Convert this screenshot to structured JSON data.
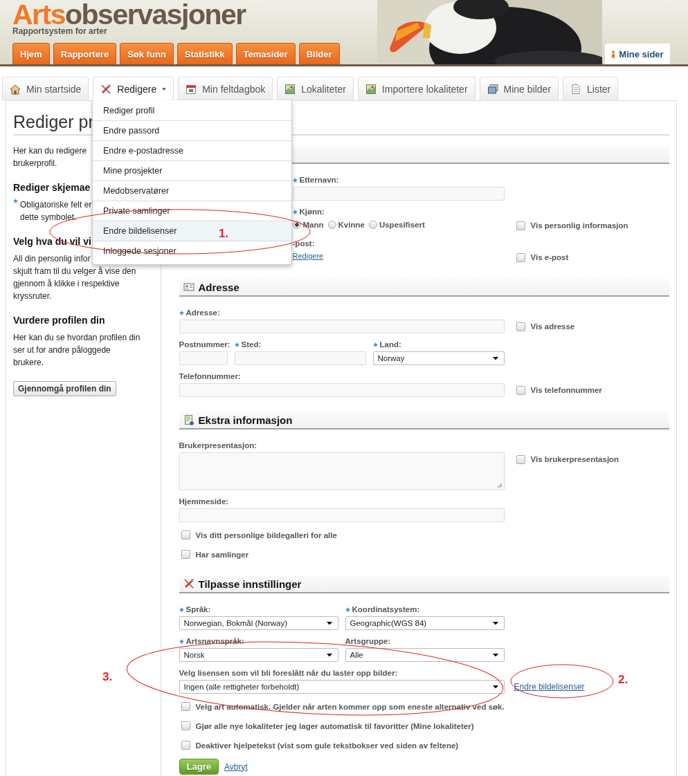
{
  "site": {
    "brand_first": "Arts",
    "brand_rest": "observasjoner",
    "tagline": "Rapportsystem for arter"
  },
  "main_nav": [
    {
      "label": "Hjem"
    },
    {
      "label": "Rapportere"
    },
    {
      "label": "Søk funn"
    },
    {
      "label": "Statistikk"
    },
    {
      "label": "Temasider"
    },
    {
      "label": "Bilder"
    }
  ],
  "user_nav": {
    "label": "Mine sider"
  },
  "tabs": [
    {
      "label": "Min startside",
      "selected": false,
      "menu": false
    },
    {
      "label": "Redigere",
      "selected": true,
      "menu": true
    },
    {
      "label": "Min feltdagbok",
      "selected": false,
      "menu": false
    },
    {
      "label": "Lokaliteter",
      "selected": false,
      "menu": false
    },
    {
      "label": "Importere lokaliteter",
      "selected": false,
      "menu": false
    },
    {
      "label": "Mine bilder",
      "selected": false,
      "menu": false
    },
    {
      "label": "Lister",
      "selected": false,
      "menu": false
    }
  ],
  "menu": {
    "items": [
      {
        "label": "Rediger profil",
        "selected": false
      },
      {
        "label": "Endre passord",
        "selected": false
      },
      {
        "label": "Endre e-postadresse",
        "selected": false
      },
      {
        "label": "Mine prosjekter",
        "selected": false
      },
      {
        "label": "Medobservatører",
        "selected": false
      },
      {
        "label": "Private samlinger",
        "selected": false
      },
      {
        "label": "Endre bildelisenser",
        "selected": true
      },
      {
        "label": "Inloggede sesjoner",
        "selected": false
      }
    ]
  },
  "page_title": "Rediger pr",
  "sidebar": [
    {
      "kind": "paragraph",
      "lines": [
        "Her kan du redigere",
        "brukerprofil."
      ]
    },
    {
      "kind": "heading",
      "text": "Rediger skjemae"
    },
    {
      "kind": "note",
      "lines": [
        "Obligatoriske felt er",
        "dette symbolet."
      ]
    },
    {
      "kind": "heading",
      "text": "Velg hva du vil vi"
    },
    {
      "kind": "paragraph",
      "lines": [
        "All din personlig infor",
        "skjult fram til du velger å vise den",
        "gjennom å klikke i respektive",
        "kryssruter."
      ]
    },
    {
      "kind": "heading",
      "text": "Vurdere profilen din"
    },
    {
      "kind": "paragraph",
      "lines": [
        "Her kan du se hvordan profilen din",
        "ser ut for andre påloggede",
        "brukere."
      ]
    },
    {
      "kind": "button",
      "text": "Gjennomgå profilen din"
    }
  ],
  "sections": [
    {
      "rows": [
        {
          "kind": "fields",
          "fields": [
            {
              "kind": "text",
              "label": "Etternavn:",
              "required": true
            }
          ]
        },
        {
          "kind": "fields",
          "fields": [
            {
              "kind": "radio",
              "label": "Kjønn:",
              "required": true,
              "options": [
                {
                  "label": "Mann",
                  "selected": true
                },
                {
                  "label": "Kvinne",
                  "selected": false
                },
                {
                  "label": "Uspesifisert",
                  "selected": false
                }
              ]
            }
          ],
          "side": {
            "kind": "checkbox",
            "label": "Vis personlig informasjon",
            "checked": false
          }
        },
        {
          "kind": "fields",
          "fields": [
            {
              "kind": "link",
              "label": "-post:",
              "required": false,
              "value": "Redigere"
            }
          ],
          "side": {
            "kind": "checkbox",
            "label": "Vis e-post",
            "checked": false
          }
        }
      ]
    },
    {
      "heading": "Adresse",
      "rows": [
        {
          "kind": "fields",
          "fields": [
            {
              "kind": "text",
              "label": "Adresse:",
              "required": true
            }
          ],
          "side": {
            "kind": "checkbox",
            "label": "Vis adresse",
            "checked": false
          }
        },
        {
          "kind": "fields",
          "fields": [
            {
              "kind": "text",
              "label": "Postnummer:",
              "required": false
            },
            {
              "kind": "text",
              "label": "Sted:",
              "required": true
            },
            {
              "kind": "select",
              "label": "Land:",
              "required": true,
              "value": "Norway"
            }
          ]
        },
        {
          "kind": "fields",
          "fields": [
            {
              "kind": "text",
              "label": "Telefonnummer:",
              "required": false
            }
          ],
          "side": {
            "kind": "checkbox",
            "label": "Vis telefonnummer",
            "checked": false
          }
        }
      ]
    },
    {
      "heading": "Ekstra informasjon",
      "rows": [
        {
          "kind": "fields",
          "fields": [
            {
              "kind": "textarea",
              "label": "Brukerpresentasjon:",
              "required": false
            }
          ],
          "side": {
            "kind": "checkbox",
            "label": "Vis brukerpresentasjon",
            "checked": false
          }
        },
        {
          "kind": "fields",
          "fields": [
            {
              "kind": "text",
              "label": "Hjemmeside:",
              "required": false
            }
          ]
        },
        {
          "kind": "checkbox",
          "label": "Vis ditt personlige bildegalleri for alle",
          "checked": false
        },
        {
          "kind": "checkbox",
          "label": "Har samlinger",
          "checked": false
        }
      ]
    },
    {
      "heading": "Tilpasse innstillinger",
      "rows": [
        {
          "kind": "fields",
          "fields": [
            {
              "kind": "select",
              "label": "Språk:",
              "required": true,
              "value": "Norwegian, Bokmål (Norway)"
            },
            {
              "kind": "select",
              "label": "Koordinatsystem:",
              "required": true,
              "value": "Geographic(WGS 84)"
            }
          ]
        },
        {
          "kind": "fields",
          "fields": [
            {
              "kind": "select",
              "label": "Artsnavnspråk:",
              "required": true,
              "value": "Norsk"
            },
            {
              "kind": "select",
              "label": "Artsgruppe:",
              "required": false,
              "value": "Alle"
            }
          ]
        },
        {
          "kind": "fields",
          "fields": [
            {
              "kind": "select",
              "label": "Velg lisensen som vil bli foreslått når du laster opp bilder:",
              "required": false,
              "value": "Ingen (alle rettigheter forbeholdt)"
            }
          ],
          "side": {
            "kind": "link",
            "label": "Endre bildelisenser"
          }
        },
        {
          "kind": "checkbox",
          "label": "Velg art automatisk. Gjelder når arten kommer opp som eneste alternativ ved søk.",
          "checked": false
        },
        {
          "kind": "checkbox",
          "label": "Gjør alle nye lokaliteter jeg lager automatisk til favoritter (Mine lokaliteter)",
          "checked": false
        },
        {
          "kind": "checkbox",
          "label": "Deaktiver hjelpetekst (vist som gule tekstbokser ved siden av feltene)",
          "checked": false
        }
      ]
    }
  ],
  "actions": [
    {
      "kind": "primary",
      "label": "Lagre"
    },
    {
      "kind": "link",
      "label": "Avbryt"
    }
  ],
  "annotations": [
    {
      "label": "1."
    },
    {
      "label": "2."
    },
    {
      "label": "3."
    }
  ]
}
